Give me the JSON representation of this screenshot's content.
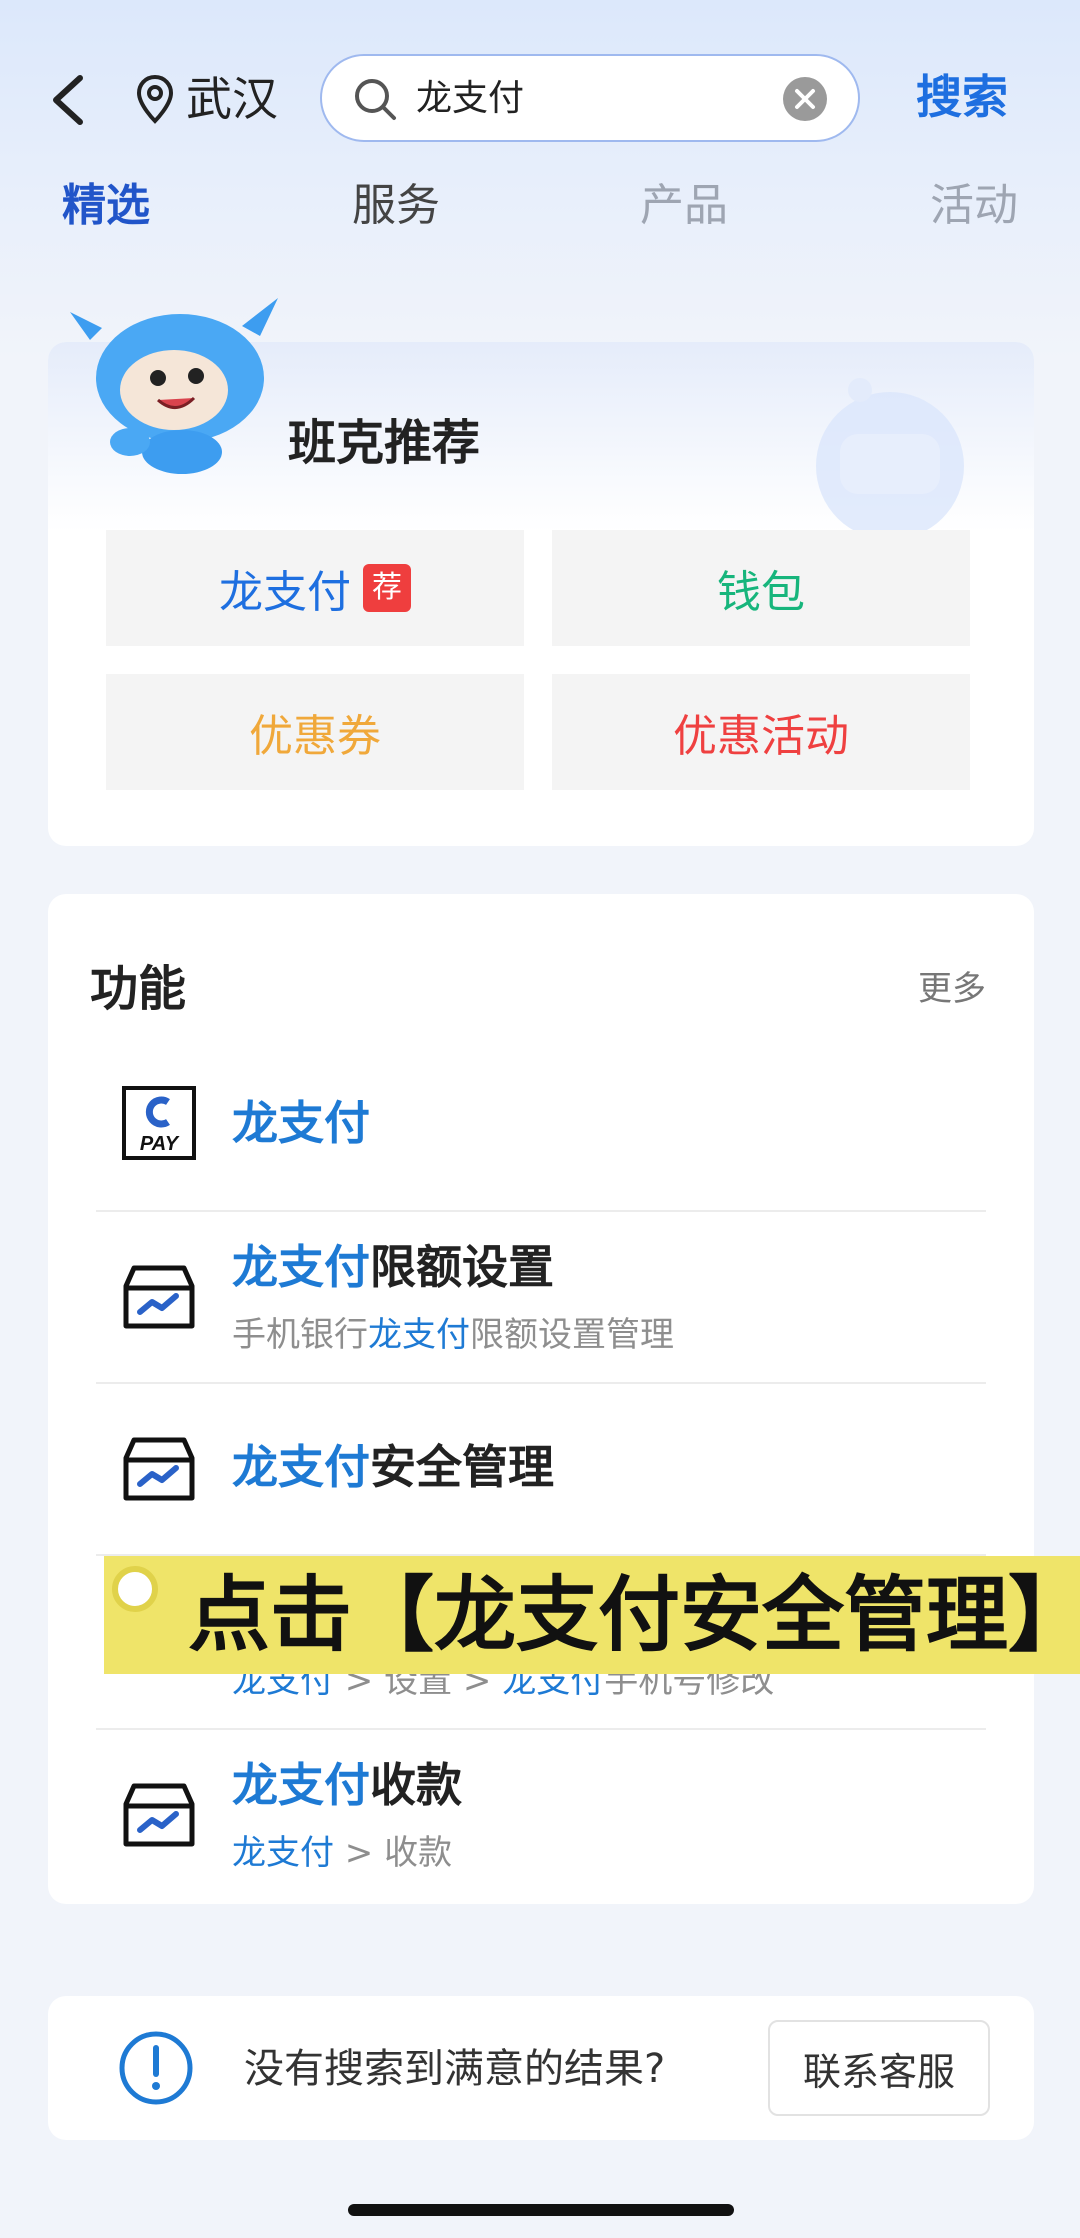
{
  "header": {
    "city": "武汉",
    "search_value": "龙支付",
    "search_button": "搜索"
  },
  "tabs": [
    {
      "label": "精选",
      "active": true
    },
    {
      "label": "服务",
      "active": false
    },
    {
      "label": "产品",
      "active": false
    },
    {
      "label": "活动",
      "active": false
    }
  ],
  "recommend": {
    "title": "班克推荐",
    "items": [
      {
        "label": "龙支付",
        "badge": "荐",
        "color": "#1e6fe0"
      },
      {
        "label": "钱包",
        "color": "#17b57c"
      },
      {
        "label": "优惠券",
        "color": "#f0a83a"
      },
      {
        "label": "优惠活动",
        "color": "#ef4040"
      }
    ]
  },
  "functions": {
    "title": "功能",
    "more": "更多",
    "rows": [
      {
        "hl": "龙支付",
        "rest": "",
        "icon": "cpay-icon"
      },
      {
        "hl": "龙支付",
        "rest": "限额设置",
        "sub_pre": "手机银行",
        "sub_hl": "龙支付",
        "sub_post": "限额设置管理",
        "icon": "box-chart-icon"
      },
      {
        "hl": "龙支付",
        "rest": "安全管理",
        "icon": "box-chart-icon"
      },
      {
        "sub_hl": "龙支付",
        "sub_mid": " > 设置 > ",
        "sub_hl2": "龙支付",
        "sub_post": "手机号修改",
        "icon": "box-chart-icon"
      },
      {
        "hl": "龙支付",
        "rest": "收款",
        "sub_hl": "龙支付",
        "sub_post": " > 收款",
        "icon": "box-chart-icon"
      }
    ]
  },
  "overlay": {
    "text": "点击【龙支付安全管理】"
  },
  "bottom": {
    "message": "没有搜索到满意的结果?",
    "contact": "联系客服"
  },
  "colors": {
    "accent": "#1e6fe0",
    "tab_active": "#2155c9",
    "highlight": "#1e7ad4",
    "banner": "#efe469"
  }
}
